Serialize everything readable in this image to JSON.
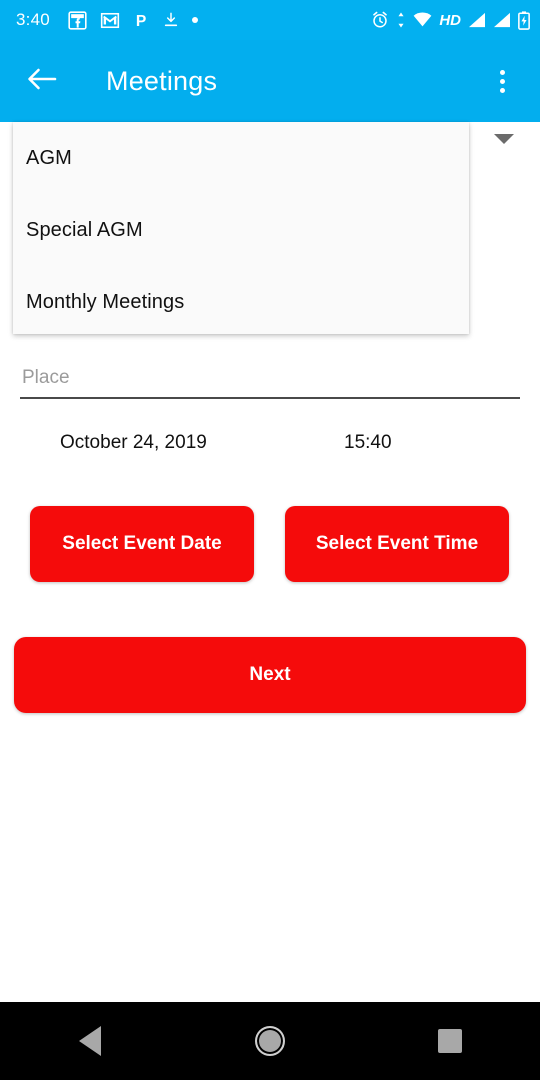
{
  "status_bar": {
    "time": "3:40",
    "left_icons": [
      "facebook-icon",
      "gmail-icon",
      "pinterest-icon",
      "download-icon",
      "dot-icon"
    ],
    "right_icons": [
      "alarm-icon",
      "data-transfer-icon",
      "wifi-icon",
      "hd-icon",
      "signal-icon-1",
      "signal-icon-2",
      "battery-charging-icon"
    ],
    "hd_label": "HD",
    "background_color": "#03B0F0"
  },
  "app_bar": {
    "back_icon": "arrow-back-icon",
    "title": "Meetings",
    "overflow_icon": "more-vertical-icon",
    "background_color": "#03AEEE"
  },
  "dropdown": {
    "expanded": true,
    "arrow_icon": "chevron-down-icon",
    "items": [
      {
        "label": "AGM"
      },
      {
        "label": "Special AGM"
      },
      {
        "label": "Monthly Meetings"
      }
    ]
  },
  "place_field": {
    "placeholder": "Place",
    "value": ""
  },
  "event": {
    "date_label": "October 24, 2019",
    "time_label": "15:40"
  },
  "buttons": {
    "select_date": "Select Event Date",
    "select_time": "Select Event Time",
    "next": "Next",
    "color": "#F50B0B"
  },
  "nav_bar": {
    "back": "nav-back-icon",
    "home": "nav-home-icon",
    "recents": "nav-recents-icon",
    "background_color": "#000000"
  }
}
